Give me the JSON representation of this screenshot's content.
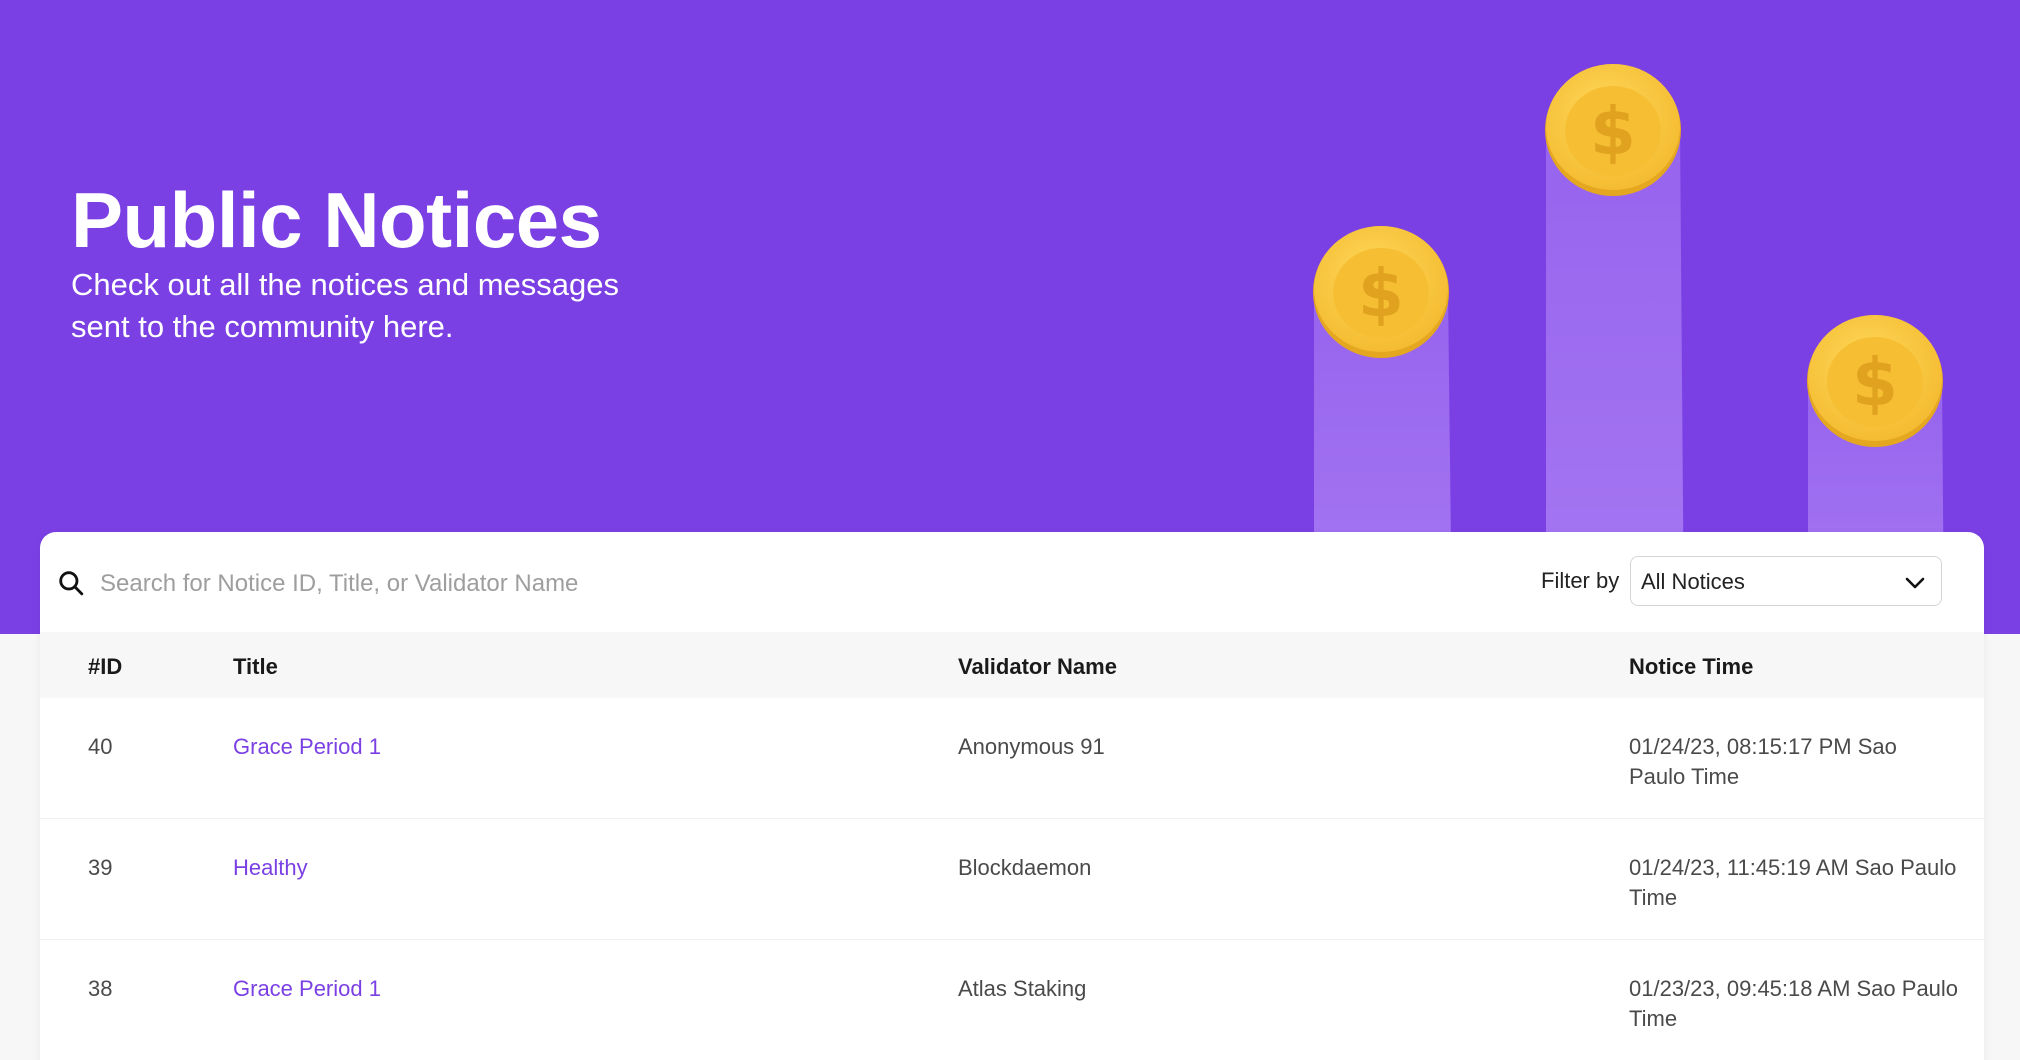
{
  "hero": {
    "title": "Public Notices",
    "subtitle": "Check out all the notices and messages sent to the community here."
  },
  "search": {
    "placeholder": "Search for Notice ID, Title, or Validator Name",
    "icon": "search-icon"
  },
  "filter": {
    "label": "Filter by",
    "selected": "All Notices",
    "icon": "chevron-down-icon"
  },
  "table": {
    "headers": [
      "#ID",
      "Title",
      "Validator Name",
      "Notice Time"
    ],
    "rows": [
      {
        "id": "40",
        "title": "Grace Period 1",
        "validator": "Anonymous 91",
        "time": "01/24/23, 08:15:17 PM Sao Paulo Time"
      },
      {
        "id": "39",
        "title": "Healthy",
        "validator": "Blockdaemon",
        "time": "01/24/23, 11:45:19 AM Sao Paulo Time"
      },
      {
        "id": "38",
        "title": "Grace Period 1",
        "validator": "Atlas Staking",
        "time": "01/23/23, 09:45:18 AM Sao Paulo Time"
      }
    ]
  },
  "colors": {
    "brand": "#7b40e4",
    "coin": "#f7c533",
    "page_bg": "#f7f7f7"
  }
}
